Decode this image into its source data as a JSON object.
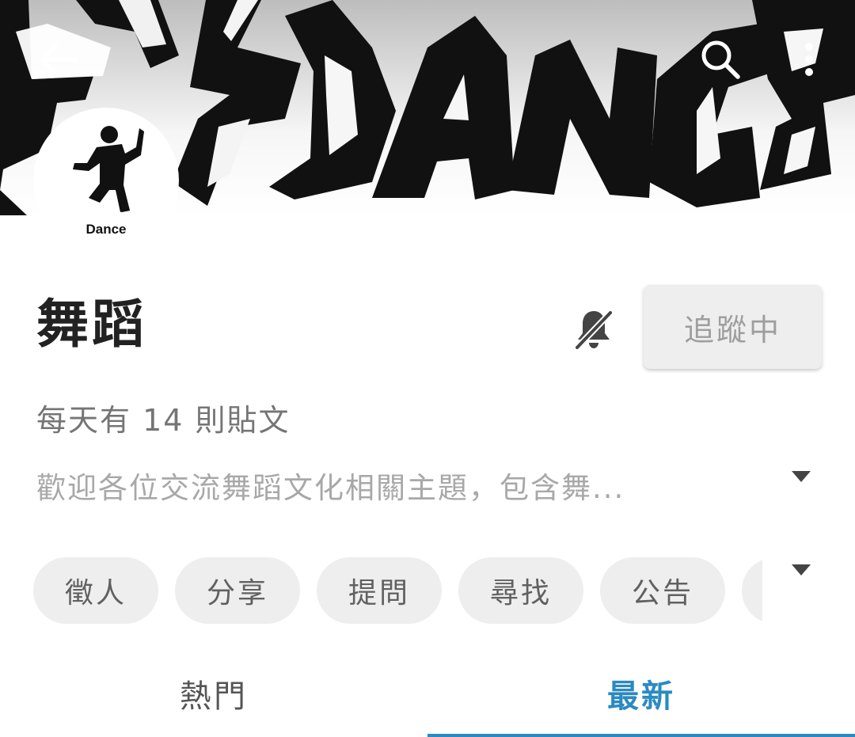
{
  "header": {
    "back_icon": "arrow-left-icon",
    "search_icon": "search-icon",
    "more_icon": "more-vert-icon"
  },
  "avatar": {
    "caption": "Dance",
    "icon": "dancer-icon"
  },
  "board": {
    "title": "舞蹈",
    "post_rate": "每天有 14 則貼文",
    "description": "歡迎各位交流舞蹈文化相關主題，包含舞...",
    "mute_icon": "bell-off-icon",
    "follow_label": "追蹤中"
  },
  "tags": [
    {
      "label": "徵人"
    },
    {
      "label": "分享"
    },
    {
      "label": "提問"
    },
    {
      "label": "尋找"
    },
    {
      "label": "公告"
    },
    {
      "label": ""
    }
  ],
  "tabs": {
    "hot": "熱門",
    "new": "最新",
    "active": "new"
  },
  "colors": {
    "accent": "#2b8ac1",
    "chip_background": "#eeeeee",
    "title_text": "#222222",
    "muted_text": "#a8a8a8"
  }
}
